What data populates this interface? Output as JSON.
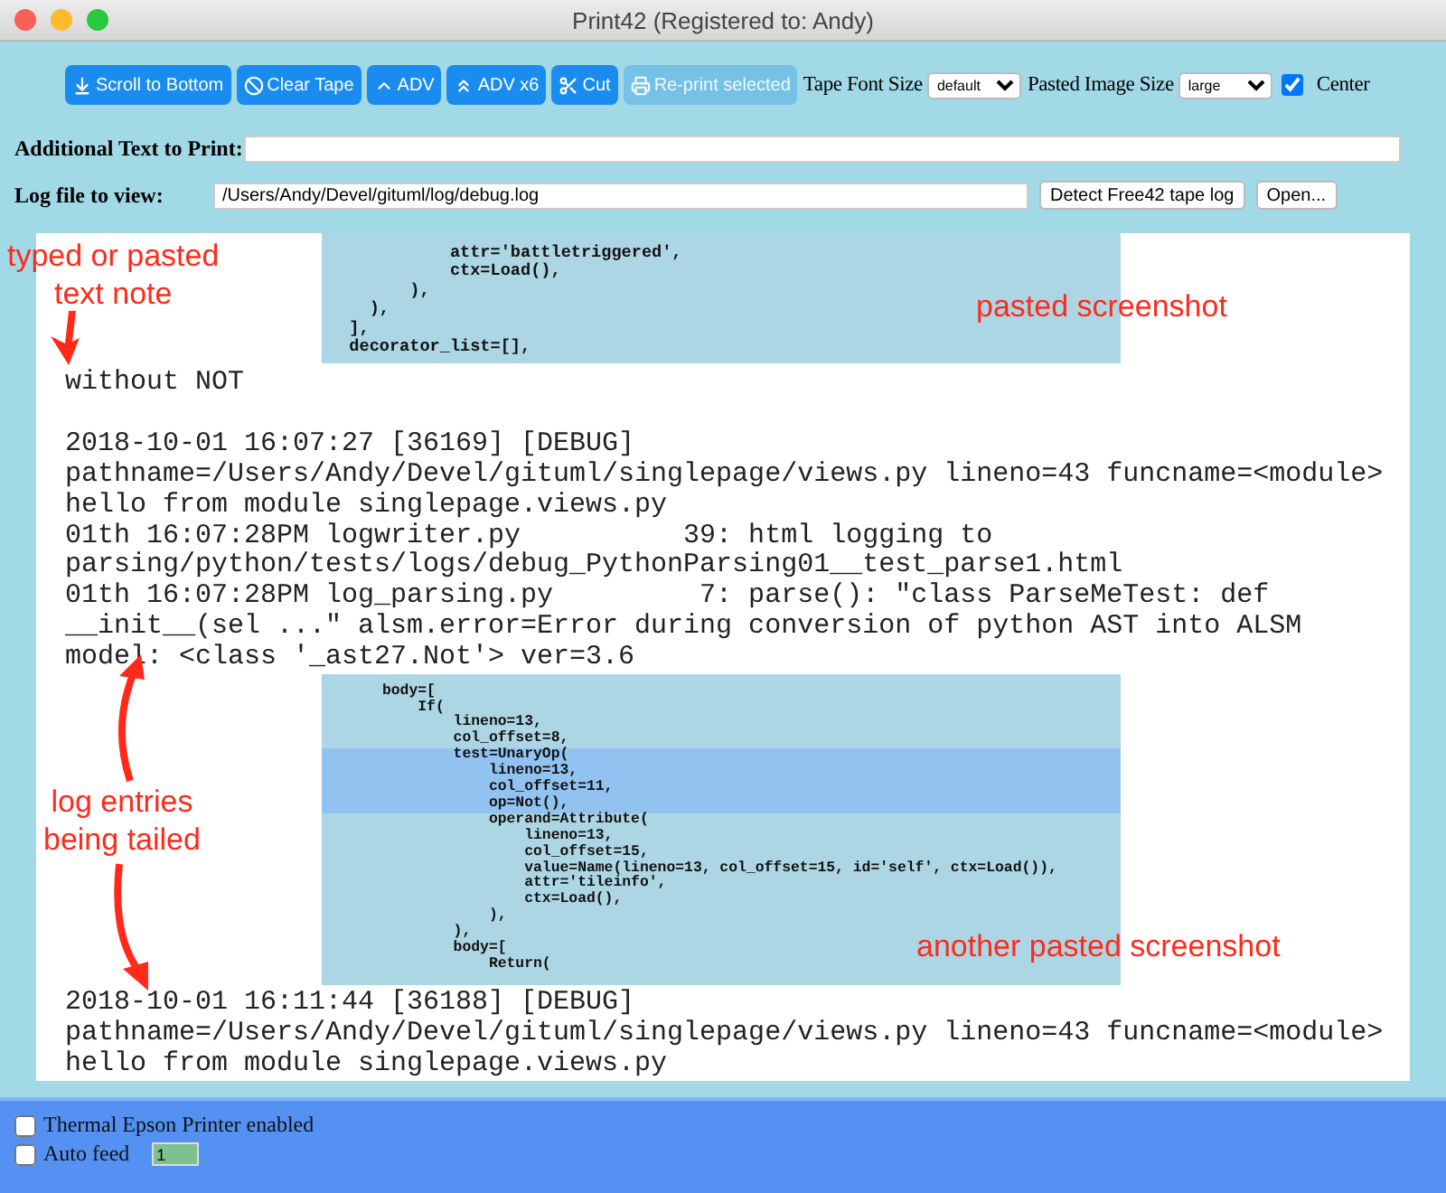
{
  "window": {
    "title": "Print42 (Registered to: Andy)"
  },
  "toolbar": {
    "buttons": [
      {
        "label": "Scroll to Bottom",
        "kind": "scroll",
        "disabled": false
      },
      {
        "label": "Clear Tape",
        "kind": "clear",
        "disabled": false
      },
      {
        "label": "ADV",
        "kind": "adv",
        "disabled": false
      },
      {
        "label": "ADV x6",
        "kind": "adv6",
        "disabled": false
      },
      {
        "label": "Cut",
        "kind": "cut",
        "disabled": false
      },
      {
        "label": "Re-print selected",
        "kind": "print",
        "disabled": true
      }
    ],
    "font_size": {
      "label": "Tape Font Size",
      "value": "default"
    },
    "image_size": {
      "label": "Pasted Image Size",
      "value": "large"
    },
    "center": {
      "label": "Center",
      "checked": true
    }
  },
  "additional_text": {
    "label": "Additional Text to Print:"
  },
  "log_file": {
    "label": "Log file to view:",
    "value": "/Users/Andy/Devel/gituml/log/debug.log",
    "buttons": [
      "Detect Free42 tape log",
      "Open..."
    ]
  },
  "tape": [
    {
      "kind": "screenshot",
      "lines": [
        {
          "text": "            attr='battletriggered',",
          "highlighted": false
        },
        {
          "text": "            ctx=Load(),",
          "highlighted": false
        },
        {
          "text": "        ),",
          "highlighted": false
        },
        {
          "text": "    ),",
          "highlighted": false
        },
        {
          "text": "  ],",
          "highlighted": false
        },
        {
          "text": "  decorator_list=[],",
          "highlighted": false
        }
      ]
    },
    {
      "kind": "text",
      "lines": [
        "without NOT"
      ]
    },
    {
      "kind": "text",
      "lines": [
        "2018-10-01 16:07:27 [36169] [DEBUG]",
        "pathname=/Users/Andy/Devel/gituml/singlepage/views.py lineno=43 funcname=<module>",
        "hello from module singlepage.views.py",
        "01th 16:07:28PM logwriter.py          39: html logging to",
        "parsing/python/tests/logs/debug_PythonParsing01__test_parse1.html",
        "01th 16:07:28PM log_parsing.py         7: parse(): \"class ParseMeTest: def",
        "__init__(sel ...\" alsm.error=Error during conversion of python AST into ALSM",
        "model: <class '_ast27.Not'> ver=3.6"
      ]
    },
    {
      "kind": "screenshot",
      "lines": [
        {
          "text": "      body=[",
          "highlighted": false
        },
        {
          "text": "          If(",
          "highlighted": false
        },
        {
          "text": "              lineno=13,",
          "highlighted": false
        },
        {
          "text": "              col_offset=8,",
          "highlighted": false
        },
        {
          "text": "              test=UnaryOp(",
          "highlighted": true
        },
        {
          "text": "                  lineno=13,",
          "highlighted": true
        },
        {
          "text": "                  col_offset=11,",
          "highlighted": true
        },
        {
          "text": "                  op=Not(),",
          "highlighted": true
        },
        {
          "text": "                  operand=Attribute(",
          "highlighted": false
        },
        {
          "text": "                      lineno=13,",
          "highlighted": false
        },
        {
          "text": "                      col_offset=15,",
          "highlighted": false
        },
        {
          "text": "                      value=Name(lineno=13, col_offset=15, id='self', ctx=Load()),",
          "highlighted": false
        },
        {
          "text": "                      attr='tileinfo',",
          "highlighted": false
        },
        {
          "text": "                      ctx=Load(),",
          "highlighted": false
        },
        {
          "text": "                  ),",
          "highlighted": false
        },
        {
          "text": "              ),",
          "highlighted": false
        },
        {
          "text": "              body=[",
          "highlighted": false
        },
        {
          "text": "                  Return(",
          "highlighted": false
        }
      ]
    },
    {
      "kind": "text",
      "lines": [
        "2018-10-01 16:11:44 [36188] [DEBUG]",
        "pathname=/Users/Andy/Devel/gituml/singlepage/views.py lineno=43 funcname=<module>",
        "hello from module singlepage.views.py"
      ]
    }
  ],
  "annotations": [
    {
      "lines": [
        "typed or pasted",
        "text note"
      ]
    },
    {
      "lines": [
        "pasted screenshot"
      ]
    },
    {
      "lines": [
        "log entries",
        "being tailed"
      ]
    },
    {
      "lines": [
        "another pasted screenshot"
      ]
    }
  ],
  "footer": {
    "options": [
      {
        "label": "Thermal Epson Printer enabled",
        "checked": false
      },
      {
        "label": "Auto feed",
        "checked": false
      }
    ],
    "feed_value": "1"
  }
}
